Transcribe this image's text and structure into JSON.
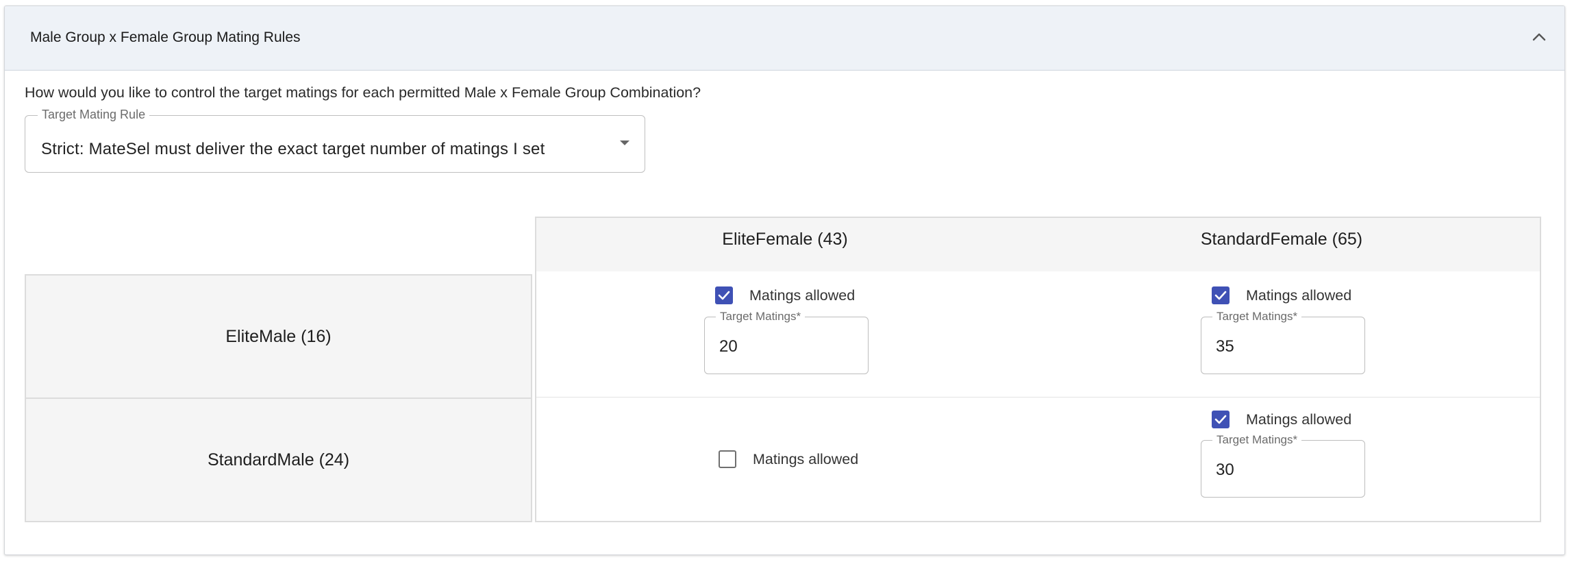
{
  "panel": {
    "title": "Male Group x Female Group Mating Rules",
    "collapse_icon": "chevron-up-icon"
  },
  "question": "How would you like to control the target matings for each permitted Male x Female Group Combination?",
  "rule_select": {
    "label": "Target Mating Rule",
    "value": "Strict: MateSel must deliver the exact target number of matings I set",
    "arrow_icon": "dropdown-arrow-icon"
  },
  "matrix": {
    "columns": [
      "EliteFemale (43)",
      "StandardFemale (65)"
    ],
    "rows": [
      "EliteMale (16)",
      "StandardMale (24)"
    ],
    "check_label": "Matings allowed",
    "target_label": "Target Matings*",
    "cells": {
      "r0c0": {
        "allowed": true,
        "target": "20"
      },
      "r0c1": {
        "allowed": true,
        "target": "35"
      },
      "r1c0": {
        "allowed": false,
        "target": ""
      },
      "r1c1": {
        "allowed": true,
        "target": "30"
      }
    }
  },
  "colors": {
    "header_bg": "#eef2f7",
    "checkbox_accent": "#3f51b5",
    "table_header_bg": "#f5f5f5"
  }
}
